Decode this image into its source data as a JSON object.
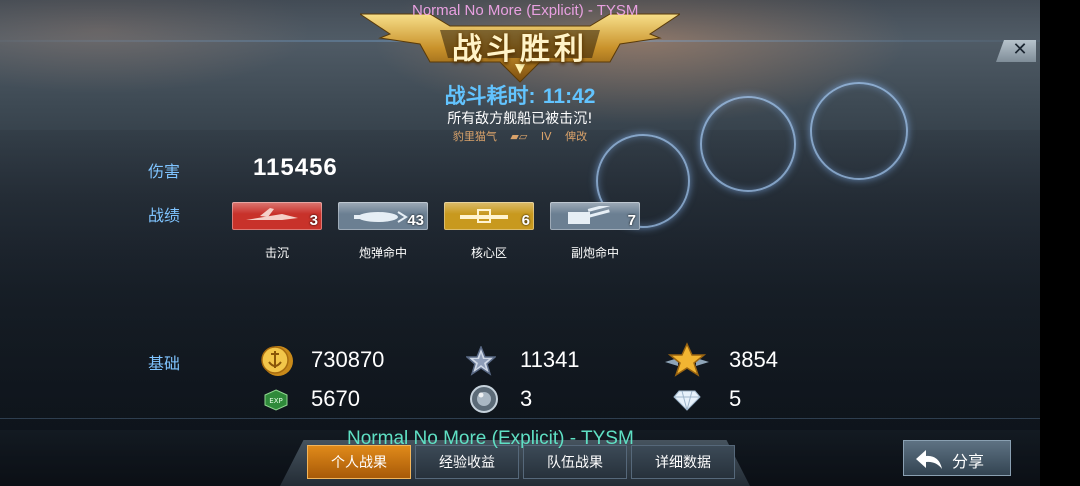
{
  "overlay": {
    "now_playing_top": "Normal No More (Explicit) - TYSM",
    "now_playing_bottom": "Normal No More (Explicit) - TYSM"
  },
  "header": {
    "title": "战斗胜利",
    "close_icon": "close-icon"
  },
  "summary": {
    "duration_label": "战斗耗时:",
    "duration_value": "11:42",
    "result_message": "所有敌方舰船已被击沉!",
    "ship_name": "豹里猫气",
    "ship_tier": "IV",
    "ship_tag": "俾改"
  },
  "damage": {
    "label": "伤害",
    "value": "115456"
  },
  "achievements": {
    "label": "战绩",
    "items": [
      {
        "name": "击沉",
        "count": "3",
        "color": "#c8322a",
        "icon": "plane-sinking-icon"
      },
      {
        "name": "炮弹命中",
        "count": "43",
        "color": "#6b7f92",
        "icon": "shell-hit-icon"
      },
      {
        "name": "核心区",
        "count": "6",
        "color": "#c8991e",
        "icon": "citadel-icon"
      },
      {
        "name": "副炮命中",
        "count": "7",
        "color": "#6b7f92",
        "icon": "secondary-gun-icon"
      }
    ]
  },
  "rewards": {
    "label": "基础",
    "items": [
      {
        "icon": "gold-coin-icon",
        "value": "730870"
      },
      {
        "icon": "silver-star-icon",
        "value": "11341"
      },
      {
        "icon": "gold-star-icon",
        "value": "3854"
      },
      {
        "icon": "exp-icon",
        "value": "5670",
        "icon_text": "EXP"
      },
      {
        "icon": "steel-orb-icon",
        "value": "3"
      },
      {
        "icon": "diamond-icon",
        "value": "5"
      }
    ]
  },
  "tabs": [
    {
      "label": "个人战果",
      "active": true
    },
    {
      "label": "经验收益",
      "active": false
    },
    {
      "label": "队伍战果",
      "active": false
    },
    {
      "label": "详细数据",
      "active": false
    }
  ],
  "share": {
    "label": "分享",
    "icon": "back-arrow-icon"
  },
  "colors": {
    "accent_blue": "#62c4ff",
    "label_blue": "#7fc4ff",
    "tab_active": "#e08a1a",
    "music_pink": "#e8a0e0",
    "music_green": "#5fe0c4"
  }
}
